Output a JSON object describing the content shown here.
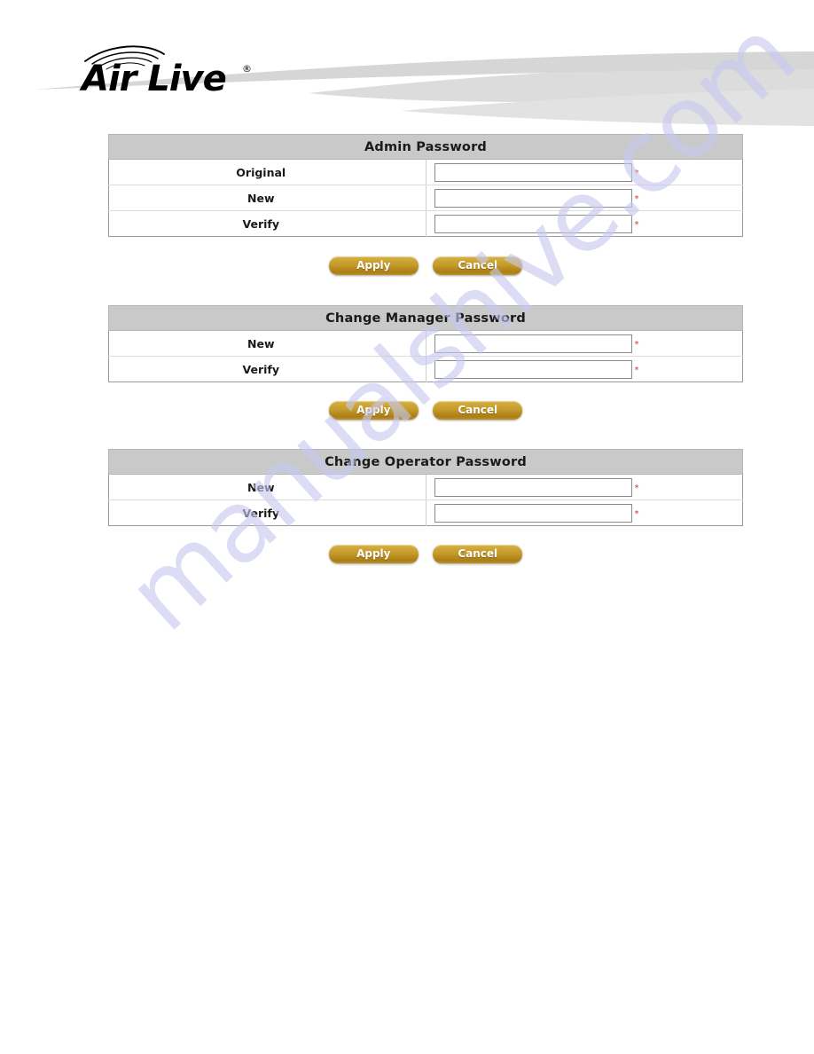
{
  "brand": {
    "logo_text": "Air Live",
    "logo_registered": "®",
    "logo_icon": "wireless-arcs-icon"
  },
  "watermark": {
    "text": "manualshive.com"
  },
  "buttons": {
    "apply_label": "Apply",
    "cancel_label": "Cancel"
  },
  "field": {
    "required_marker": "*",
    "placeholder": "",
    "value": ""
  },
  "colors": {
    "section_header_bg": "#c9c9c9",
    "button_gold": "#c49b2b",
    "required_red": "#cf3030",
    "watermark": "#c7c8f0",
    "swoosh_gray": "#d9d9d9",
    "table_border": "#9a9a9a"
  },
  "sections": [
    {
      "title": "Admin Password",
      "rows": [
        {
          "label": "Original",
          "value": "",
          "required": "*"
        },
        {
          "label": "New",
          "value": "",
          "required": "*"
        },
        {
          "label": "Verify",
          "value": "",
          "required": "*"
        }
      ]
    },
    {
      "title": "Change Manager Password",
      "rows": [
        {
          "label": "New",
          "value": "",
          "required": "*"
        },
        {
          "label": "Verify",
          "value": "",
          "required": "*"
        }
      ]
    },
    {
      "title": "Change Operator Password",
      "rows": [
        {
          "label": "New",
          "value": "",
          "required": "*"
        },
        {
          "label": "Verify",
          "value": "",
          "required": "*"
        }
      ]
    }
  ]
}
